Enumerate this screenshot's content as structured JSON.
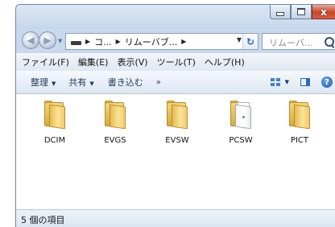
{
  "window": {
    "caption_buttons": {
      "close_glyph": "x"
    }
  },
  "nav": {
    "address_crumbs": [
      "コ...",
      "リムーバブ..."
    ],
    "search_placeholder": "リムーバ..."
  },
  "menu": {
    "items": [
      "ファイル(F)",
      "編集(E)",
      "表示(V)",
      "ツール(T)",
      "ヘルプ(H)"
    ]
  },
  "toolbar": {
    "organize_label": "整理",
    "share_label": "共有",
    "burn_label": "書き込む",
    "more_label": "»"
  },
  "content": {
    "items": [
      {
        "name": "DCIM",
        "icon": "folder-icon"
      },
      {
        "name": "EVGS",
        "icon": "folder-icon"
      },
      {
        "name": "EVSW",
        "icon": "folder-icon"
      },
      {
        "name": "PCSW",
        "icon": "document-folder-icon"
      },
      {
        "name": "PICT",
        "icon": "folder-icon"
      }
    ]
  },
  "status": {
    "item_count_text": "5 個の項目"
  }
}
